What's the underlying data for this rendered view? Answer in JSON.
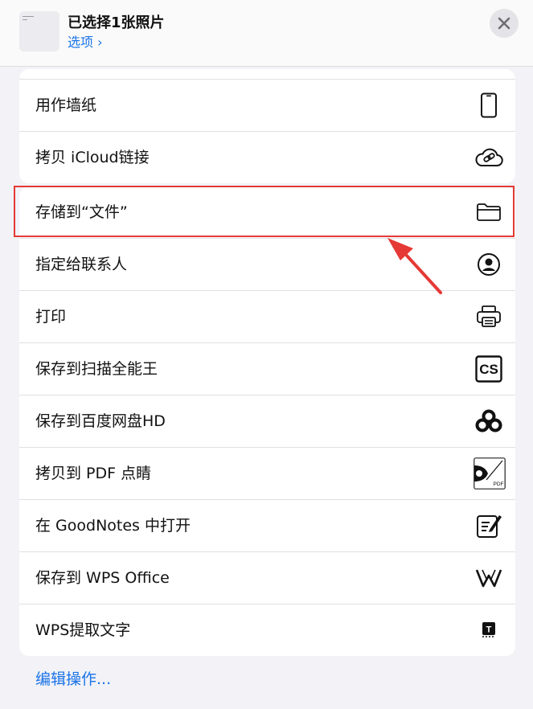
{
  "header": {
    "title": "已选择1张照片",
    "options_label": "选项 ›"
  },
  "group1": [
    {
      "label": "用作墙纸",
      "icon": "phone-icon"
    },
    {
      "label": "拷贝 iCloud链接",
      "icon": "icloud-link-icon"
    }
  ],
  "group2": [
    {
      "label": "存储到“文件”",
      "icon": "folder-icon"
    },
    {
      "label": "指定给联系人",
      "icon": "contact-icon"
    },
    {
      "label": "打印",
      "icon": "printer-icon"
    },
    {
      "label": "保存到扫描全能王",
      "icon": "camscanner-icon"
    },
    {
      "label": "保存到百度网盘HD",
      "icon": "baidu-netdisk-icon"
    },
    {
      "label": "拷贝到 PDF 点睛",
      "icon": "pdf-expert-icon"
    },
    {
      "label": "在 GoodNotes 中打开",
      "icon": "goodnotes-icon"
    },
    {
      "label": "保存到 WPS Office",
      "icon": "wps-office-icon"
    },
    {
      "label": "WPS提取文字",
      "icon": "wps-extract-text-icon"
    }
  ],
  "icon_texts": {
    "camscanner": "CS",
    "pdf": "PDF",
    "wps_extract": "T"
  },
  "footer": {
    "edit_actions": "编辑操作..."
  },
  "colors": {
    "accent": "#1a73e8",
    "highlight": "#e53935"
  }
}
